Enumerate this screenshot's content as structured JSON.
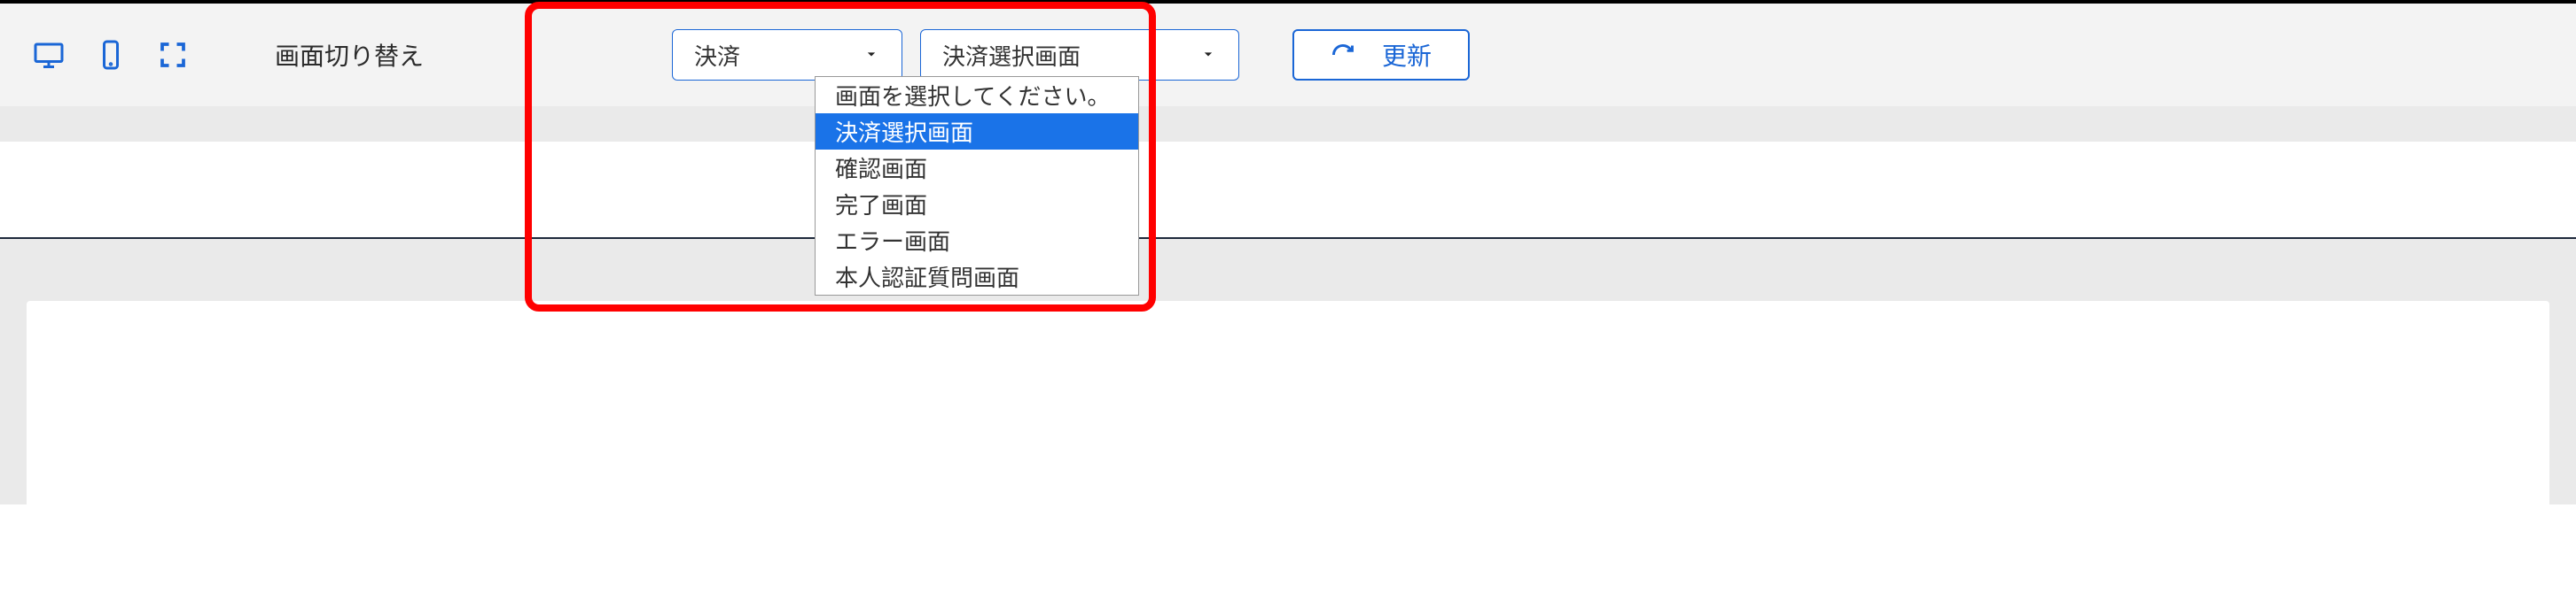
{
  "toolbar": {
    "switch_label": "画面切り替え",
    "select1": {
      "value": "決済"
    },
    "select2": {
      "value": "決済選択画面",
      "options": [
        "画面を選択してください。",
        "決済選択画面",
        "確認画面",
        "完了画面",
        "エラー画面",
        "本人認証質問画面"
      ],
      "selected_index": 1
    },
    "refresh_label": "更新"
  }
}
